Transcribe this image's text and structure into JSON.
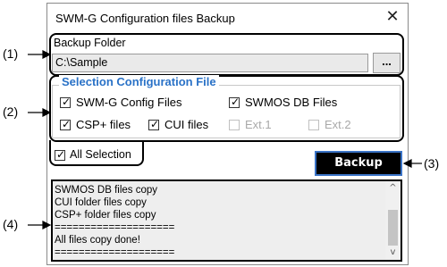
{
  "dialog": {
    "title": "SWM-G Configuration files Backup",
    "close_glyph": "✕"
  },
  "backup_folder": {
    "label": "Backup Folder",
    "value": "C:\\Sample",
    "browse_label": "..."
  },
  "selection": {
    "title": "Selection Configuration File",
    "items": [
      {
        "label": "SWM-G Config Files",
        "checked": true,
        "enabled": true
      },
      {
        "label": "SWMOS DB Files",
        "checked": true,
        "enabled": true
      },
      {
        "label": "CSP+ files",
        "checked": true,
        "enabled": true
      },
      {
        "label": "CUI files",
        "checked": true,
        "enabled": true
      },
      {
        "label": "Ext.1",
        "checked": false,
        "enabled": false
      },
      {
        "label": "Ext.2",
        "checked": false,
        "enabled": false
      }
    ]
  },
  "all_selection": {
    "label": "All Selection",
    "checked": true
  },
  "backup_button": {
    "label": "Backup"
  },
  "log": {
    "lines": [
      "SWMOS DB files copy",
      "CUI folder files copy",
      "CSP+ folder files copy",
      "====================",
      "All files copy done!",
      "===================="
    ],
    "scroll_up": "^",
    "scroll_down": "v"
  },
  "callouts": [
    "(1)",
    "(2)",
    "(3)",
    "(4)"
  ],
  "check_glyph": "✓"
}
